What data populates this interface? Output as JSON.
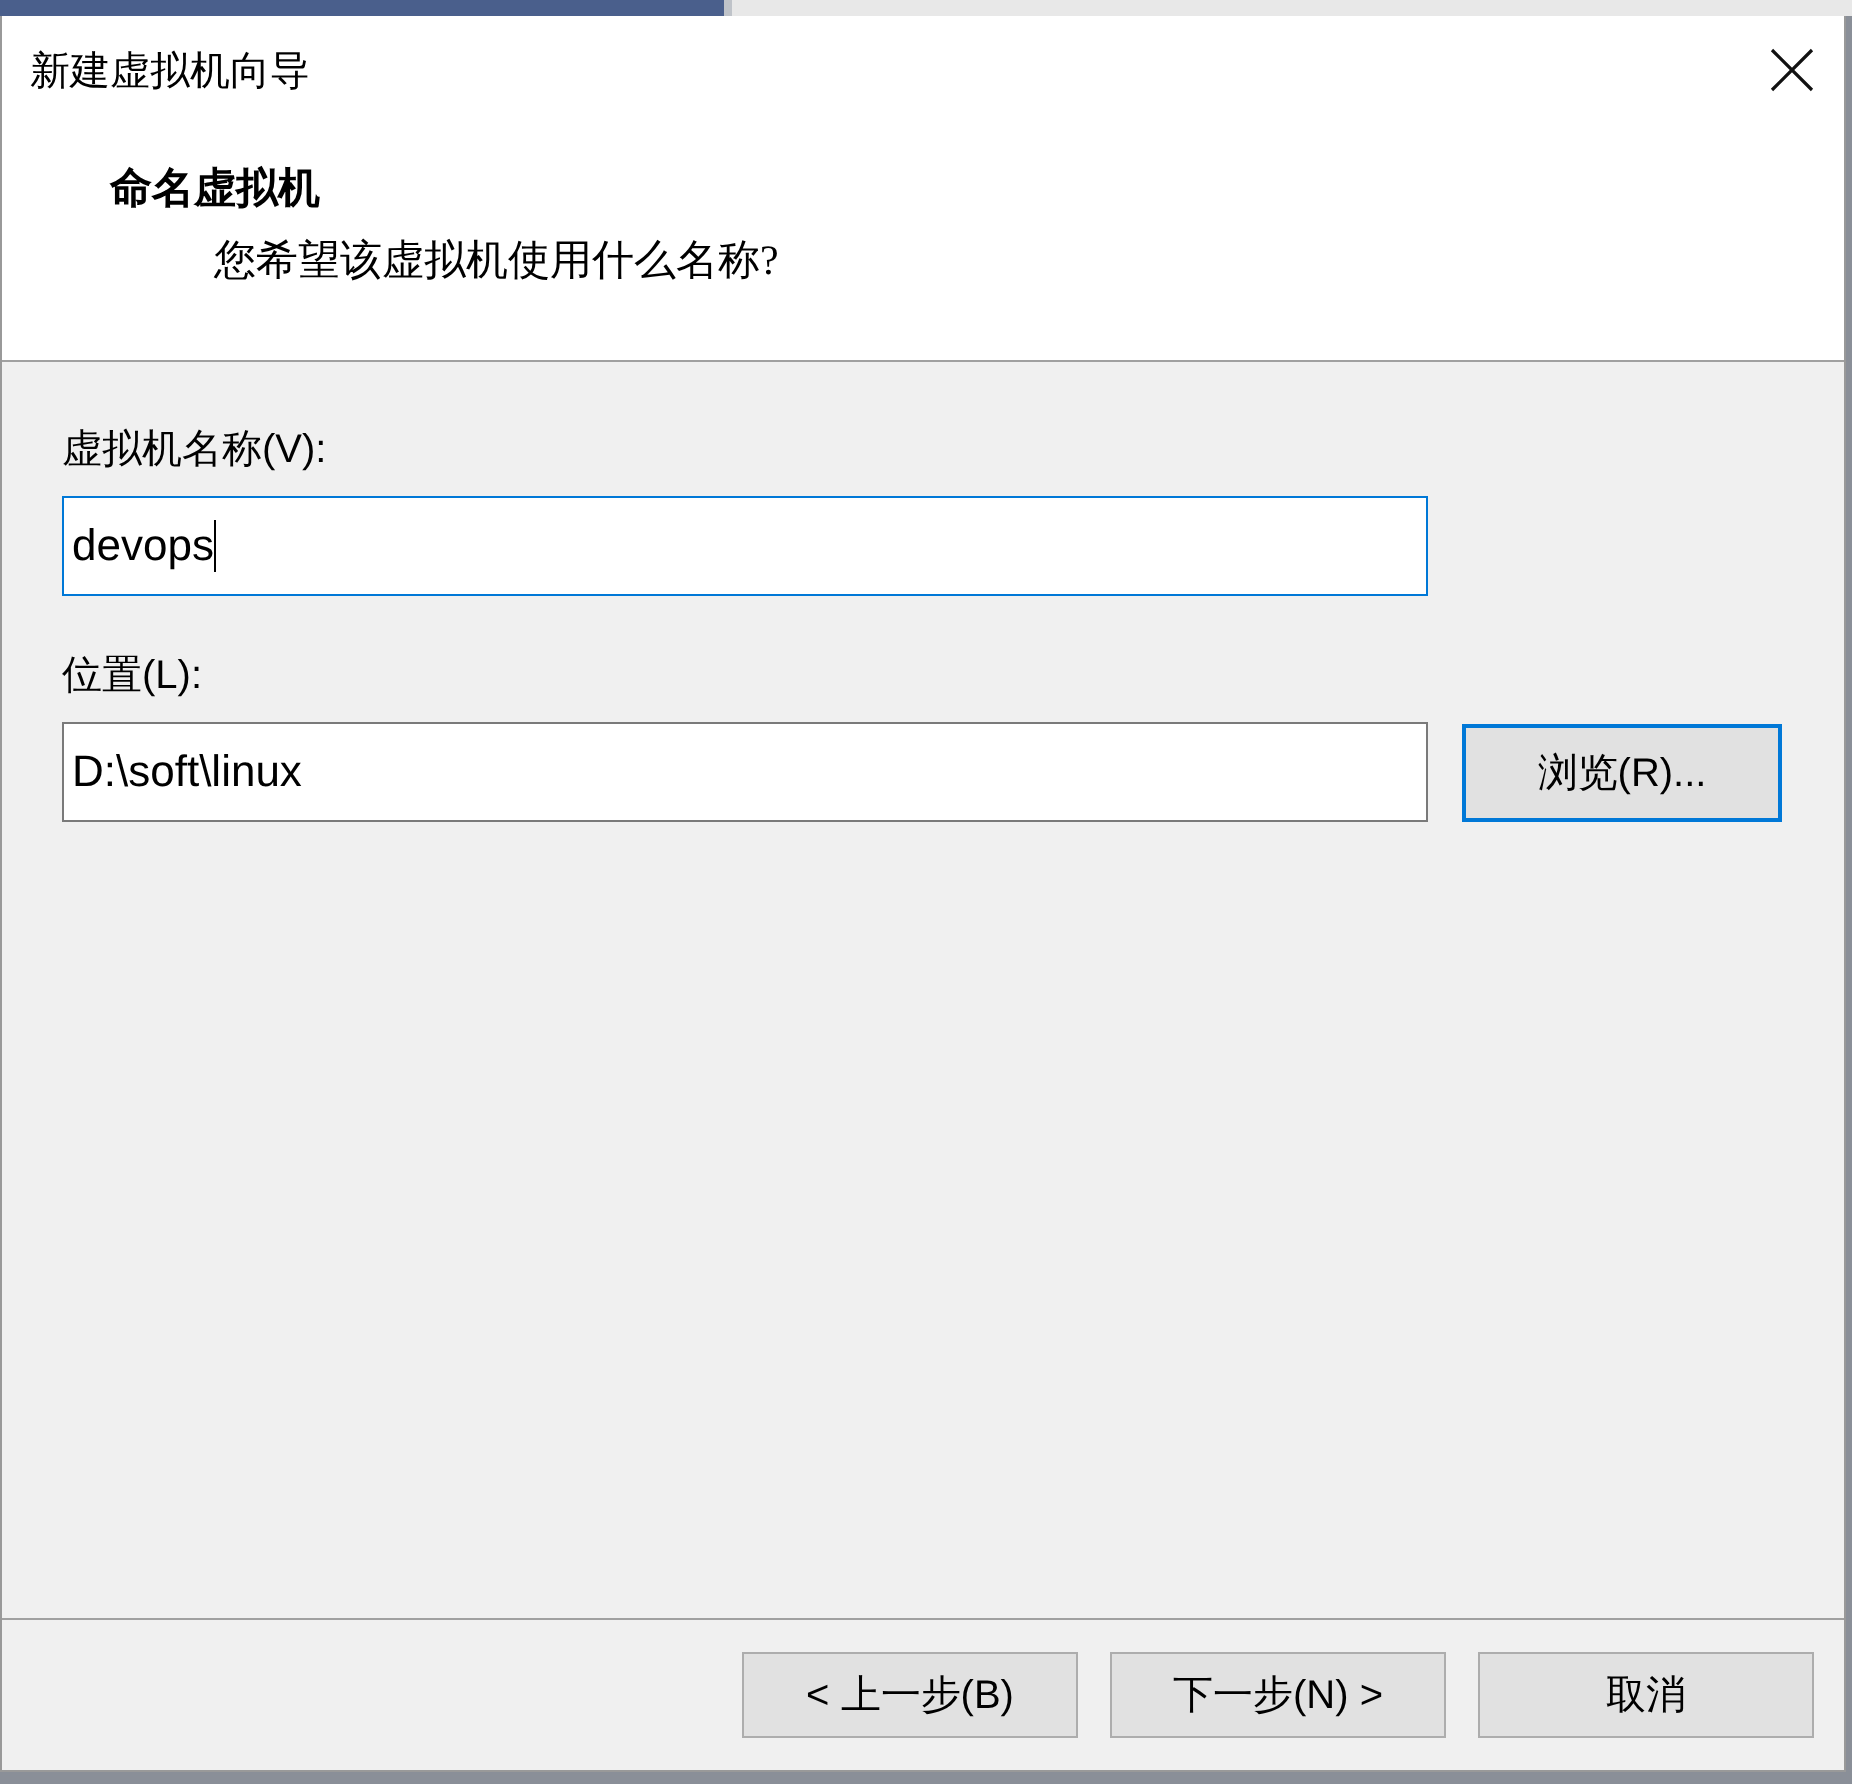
{
  "window": {
    "title": "新建虚拟机向导"
  },
  "header": {
    "title": "命名虚拟机",
    "subtitle": "您希望该虚拟机使用什么名称?"
  },
  "fields": [
    {
      "label": "虚拟机名称(V):",
      "value": "devops",
      "focused": true
    },
    {
      "label": "位置(L):",
      "value": "D:\\soft\\linux",
      "focused": false,
      "browse_button": {
        "label": "浏览(R)...",
        "default": true
      }
    }
  ],
  "buttons": [
    {
      "label": "< 上一步(B)"
    },
    {
      "label": "下一步(N) >"
    },
    {
      "label": "取消"
    }
  ]
}
